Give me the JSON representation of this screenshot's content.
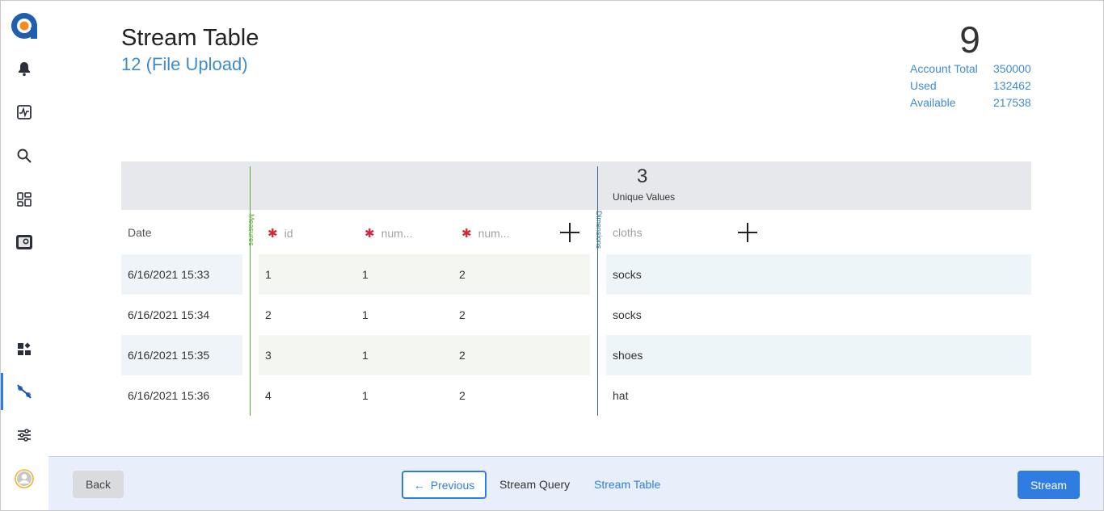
{
  "header": {
    "title": "Stream Table",
    "subtitle": "12 (File Upload)",
    "count": "9",
    "account": [
      {
        "label": "Account Total",
        "value": "350000"
      },
      {
        "label": "Used",
        "value": "132462"
      },
      {
        "label": "Available",
        "value": "217538"
      }
    ]
  },
  "sidebar": {
    "icons": [
      "logo-icon",
      "bell-icon",
      "activity-icon",
      "search-icon",
      "widgets-icon",
      "media-icon",
      "dashboard-icon",
      "stream-icon",
      "sliders-icon",
      "avatar-icon"
    ],
    "active": "stream-icon",
    "accent": "#2f7de1"
  },
  "table": {
    "unique_values_count": "3",
    "unique_values_label": "Unique Values",
    "measures_label": "Measures",
    "dimensions_label": "Dimensions",
    "columns": {
      "date": "Date",
      "id": "id",
      "num1": "num...",
      "num2": "num...",
      "cloths": "cloths"
    },
    "rows": [
      {
        "date": "6/16/2021 15:33",
        "id": "1",
        "num1": "1",
        "num2": "2",
        "cloths": "socks"
      },
      {
        "date": "6/16/2021 15:34",
        "id": "2",
        "num1": "1",
        "num2": "2",
        "cloths": "socks"
      },
      {
        "date": "6/16/2021 15:35",
        "id": "3",
        "num1": "1",
        "num2": "2",
        "cloths": "shoes"
      },
      {
        "date": "6/16/2021 15:36",
        "id": "4",
        "num1": "1",
        "num2": "2",
        "cloths": "hat"
      }
    ]
  },
  "footer": {
    "back_label": "Back",
    "previous_label": "Previous",
    "crumb_query": "Stream Query",
    "crumb_table": "Stream Table",
    "stream_label": "Stream"
  },
  "colors": {
    "primary": "#2f7de1",
    "measures_line": "#5fa83b",
    "dimensions_line": "#2e6e8f",
    "required_star": "#d3273b"
  }
}
